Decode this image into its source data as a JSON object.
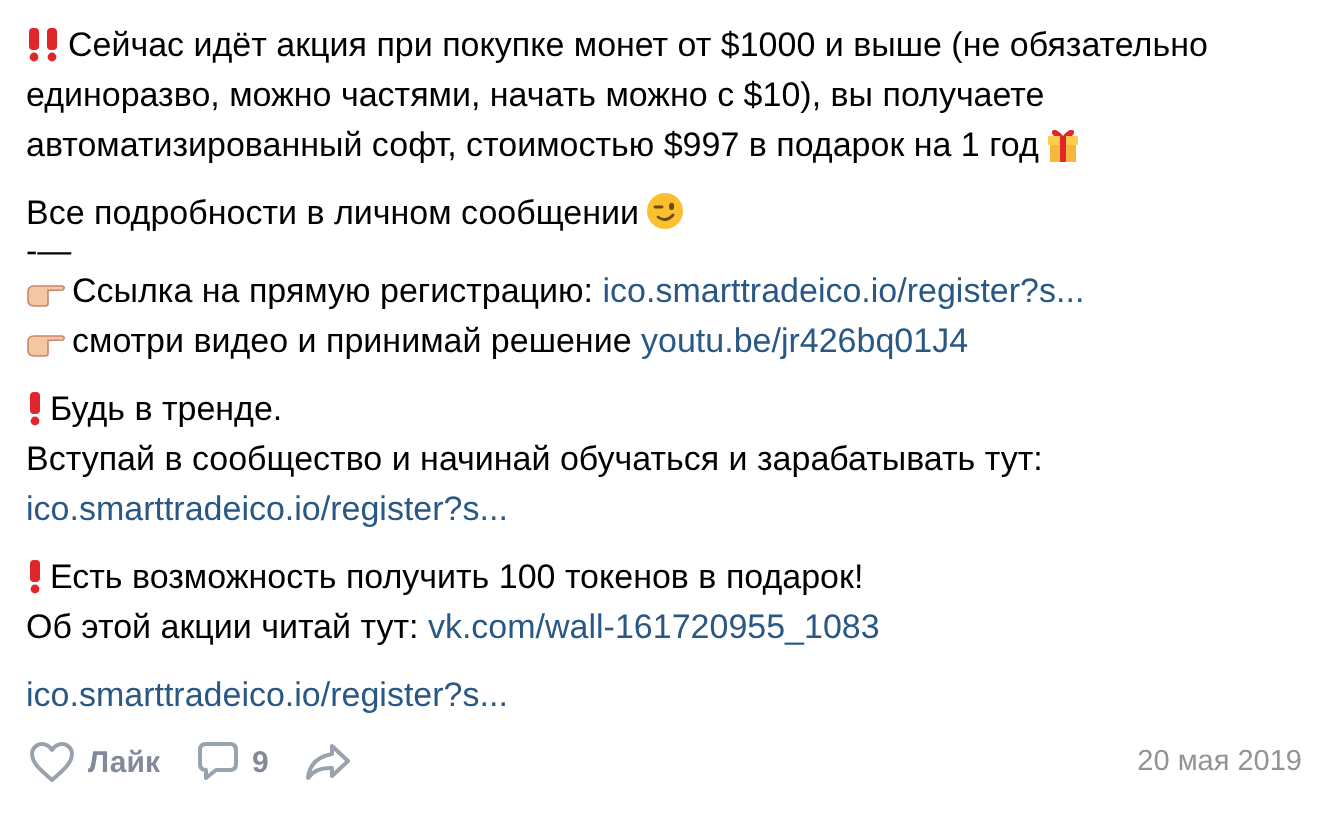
{
  "post": {
    "blocks": [
      {
        "lines": [
          {
            "segments": [
              {
                "kind": "double-exclamation"
              },
              {
                "kind": "text",
                "text": "Сейчас идёт акция при покупке монет от $1000 и выше (не обязательно единоразво, можно частями, начать можно с $10), вы получаете автоматизированный софт, стоимостью $997 в подарок на 1 год"
              },
              {
                "kind": "gift"
              }
            ]
          }
        ]
      },
      {
        "lines": [
          {
            "segments": [
              {
                "kind": "text",
                "text": "Все подробности в личном сообщении"
              },
              {
                "kind": "wink"
              }
            ]
          },
          {
            "segments": [
              {
                "kind": "text",
                "text": "-—"
              }
            ]
          },
          {
            "segments": [
              {
                "kind": "pointing-hand"
              },
              {
                "kind": "text",
                "text": "Ссылка на прямую регистрацию:"
              },
              {
                "kind": "link",
                "text": "ico.smarttradeico.io/register?s..."
              }
            ]
          },
          {
            "segments": [
              {
                "kind": "pointing-hand"
              },
              {
                "kind": "text",
                "text": "смотри видео и принимай решение"
              },
              {
                "kind": "link",
                "text": "youtu.be/jr426bq01J4"
              }
            ]
          }
        ]
      },
      {
        "lines": [
          {
            "segments": [
              {
                "kind": "exclamation"
              },
              {
                "kind": "text",
                "text": "Будь в тренде."
              }
            ]
          },
          {
            "segments": [
              {
                "kind": "text",
                "text": "Вступай в сообщество и начинай обучаться и зарабатывать тут:"
              }
            ]
          },
          {
            "segments": [
              {
                "kind": "link",
                "text": "ico.smarttradeico.io/register?s..."
              }
            ]
          }
        ]
      },
      {
        "lines": [
          {
            "segments": [
              {
                "kind": "exclamation"
              },
              {
                "kind": "text",
                "text": "Есть возможность получить 100 токенов в подарок!"
              }
            ]
          },
          {
            "segments": [
              {
                "kind": "text",
                "text": "Об этой акции читай тут:"
              },
              {
                "kind": "link",
                "text": "vk.com/wall-161720955_1083"
              }
            ]
          }
        ]
      },
      {
        "lines": [
          {
            "segments": [
              {
                "kind": "link",
                "text": "ico.smarttradeico.io/register?s..."
              }
            ]
          }
        ]
      }
    ],
    "footer": {
      "like": {
        "label": "Лайк",
        "liked": false
      },
      "comments": {
        "count": "9"
      },
      "date": "20 мая 2019"
    }
  }
}
